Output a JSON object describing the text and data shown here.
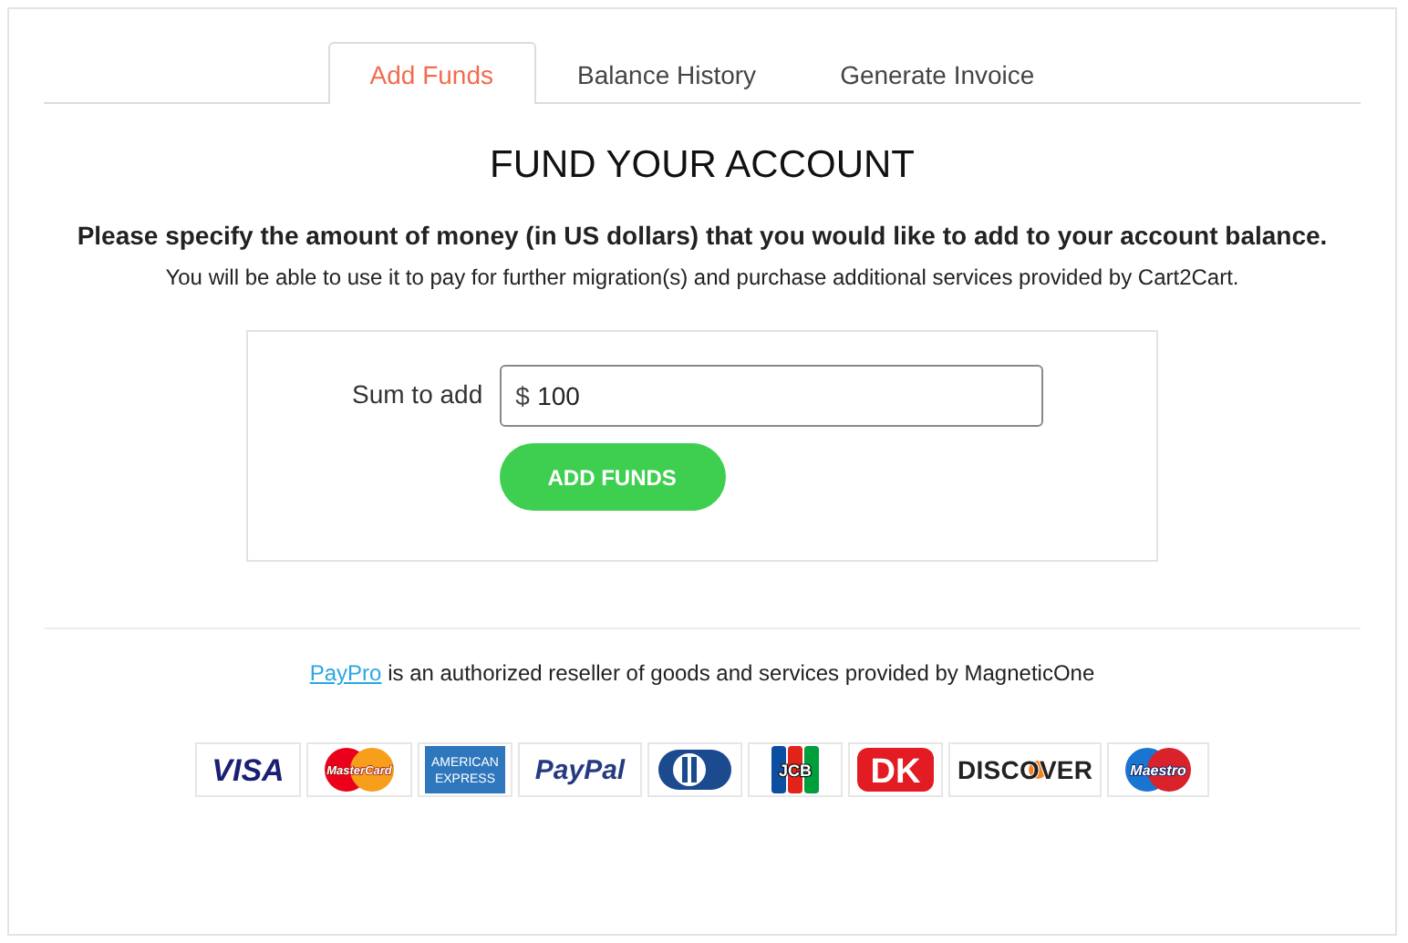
{
  "tabs": [
    {
      "label": "Add Funds",
      "selected": true
    },
    {
      "label": "Balance History",
      "selected": false
    },
    {
      "label": "Generate Invoice",
      "selected": false
    }
  ],
  "title": "FUND YOUR ACCOUNT",
  "intro": "Please specify the amount of money (in US dollars) that you would like to add to your account balance.",
  "note": "You will be able to use it to pay for further migration(s) and purchase additional services provided by Cart2Cart.",
  "form": {
    "label": "Sum to add",
    "prefix": "$",
    "value": "100",
    "button": "ADD FUNDS"
  },
  "reseller": {
    "link": "PayPro",
    "text": "is an authorized reseller of goods and services provided by MagneticOne"
  },
  "payment_logos": [
    {
      "kind": "visa",
      "label": "VISA"
    },
    {
      "kind": "mastercard",
      "label": "MasterCard"
    },
    {
      "kind": "amex",
      "label": "AMERICAN EXPRESS"
    },
    {
      "kind": "paypal",
      "label": "PayPal"
    },
    {
      "kind": "diners"
    },
    {
      "kind": "jcb",
      "label": "JCB"
    },
    {
      "kind": "dankort",
      "label": "DK"
    },
    {
      "kind": "discover",
      "label": "DISCOVER"
    },
    {
      "kind": "maestro",
      "label": "Maestro"
    }
  ]
}
